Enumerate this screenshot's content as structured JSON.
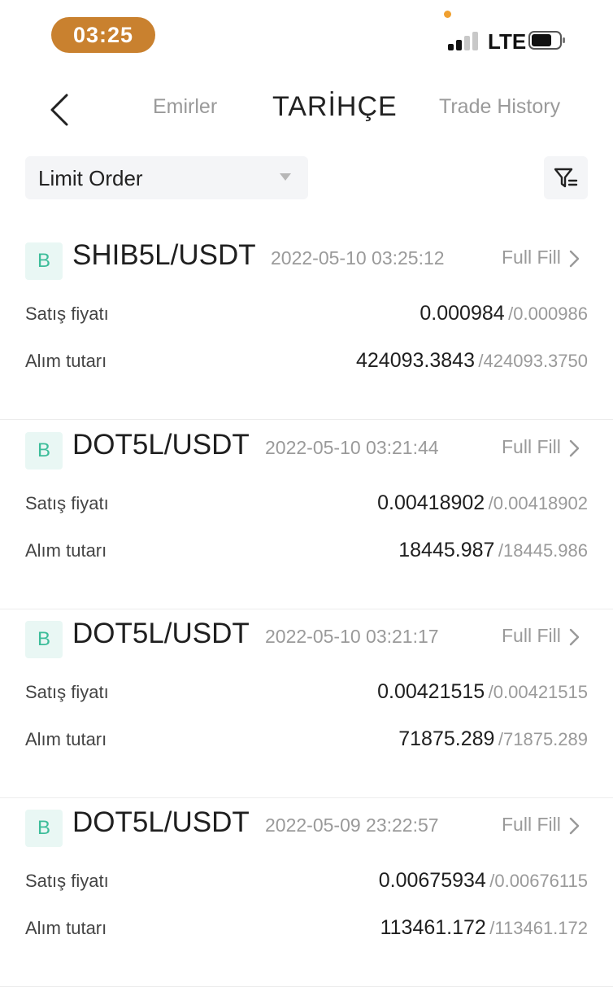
{
  "status_bar": {
    "time": "03:25",
    "network": "LTE",
    "signal_bars": 2,
    "accent_color": "#c9812f"
  },
  "header": {
    "back_icon": "chevron-left-icon",
    "tabs": [
      {
        "label": "Emirler",
        "active": false
      },
      {
        "label": "TARİHÇE",
        "active": true
      },
      {
        "label": "Trade History",
        "active": false
      }
    ]
  },
  "filters": {
    "order_type": "Limit Order",
    "filter_icon": "filter-icon"
  },
  "labels": {
    "price": "Satış fiyatı",
    "amount": "Alım tutarı"
  },
  "orders": [
    {
      "side": "B",
      "pair": "SHIB5L/USDT",
      "time": "2022-05-10 03:25:12",
      "status": "Full Fill",
      "price": "0.000984",
      "price_ref": "/0.000986",
      "amount": "424093.3843",
      "amount_ref": "/424093.3750"
    },
    {
      "side": "B",
      "pair": "DOT5L/USDT",
      "time": "2022-05-10 03:21:44",
      "status": "Full Fill",
      "price": "0.00418902",
      "price_ref": "/0.00418902",
      "amount": "18445.987",
      "amount_ref": "/18445.986"
    },
    {
      "side": "B",
      "pair": "DOT5L/USDT",
      "time": "2022-05-10 03:21:17",
      "status": "Full Fill",
      "price": "0.00421515",
      "price_ref": "/0.00421515",
      "amount": "71875.289",
      "amount_ref": "/71875.289"
    },
    {
      "side": "B",
      "pair": "DOT5L/USDT",
      "time": "2022-05-09 23:22:57",
      "status": "Full Fill",
      "price": "0.00675934",
      "price_ref": "/0.00676115",
      "amount": "113461.172",
      "amount_ref": "/113461.172"
    }
  ],
  "colors": {
    "buy_badge_text": "#3dbd9a",
    "buy_badge_bg": "#e9f7f4",
    "muted_text": "#9a9a9a"
  }
}
